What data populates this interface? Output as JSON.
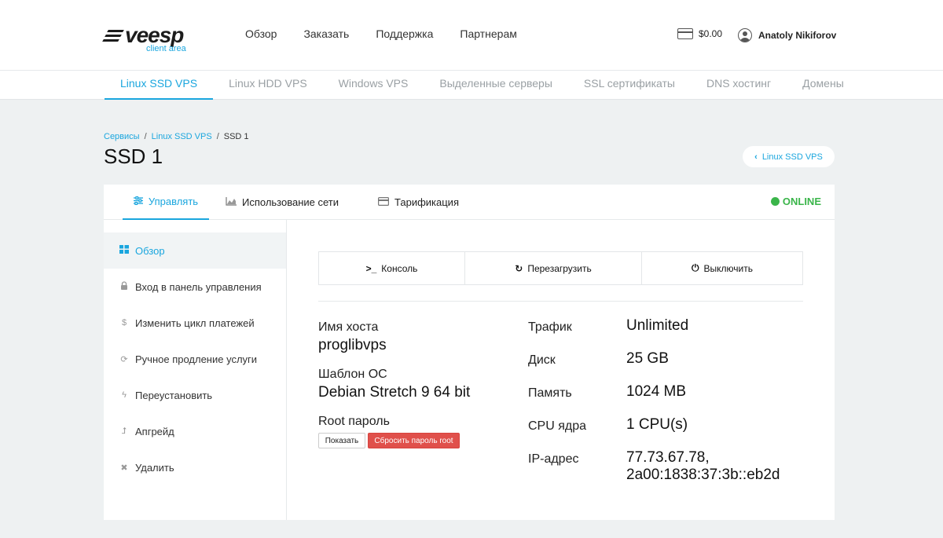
{
  "header": {
    "logo_text": "veesp",
    "logo_sub": "client area",
    "nav": [
      "Обзор",
      "Заказать",
      "Поддержка",
      "Партнерам"
    ],
    "balance": "$0.00",
    "user_name": "Anatoly Nikiforov"
  },
  "subnav": [
    "Linux SSD VPS",
    "Linux HDD VPS",
    "Windows VPS",
    "Выделенные серверы",
    "SSL сертификаты",
    "DNS хостинг",
    "Домены"
  ],
  "breadcrumb": {
    "root": "Сервисы",
    "section": "Linux SSD VPS",
    "current": "SSD 1"
  },
  "page_title": "SSD 1",
  "back_button": "Linux SSD VPS",
  "tabs": [
    "Управлять",
    "Использование сети",
    "Тарификация"
  ],
  "status": "ONLINE",
  "sidebar": [
    "Обзор",
    "Вход в панель управления",
    "Изменить цикл платежей",
    "Ручное продление услуги",
    "Переустановить",
    "Апгрейд",
    "Удалить"
  ],
  "actions": {
    "console": "Консоль",
    "reboot": "Перезагрузить",
    "shutdown": "Выключить"
  },
  "info_left": {
    "hostname_label": "Имя хоста",
    "hostname": "proglibvps",
    "os_label": "Шаблон ОС",
    "os": "Debian Stretch 9 64 bit",
    "root_label": "Root пароль",
    "show_btn": "Показать",
    "reset_btn": "Сбросить пароль root"
  },
  "info_right": {
    "traffic_label": "Трафик",
    "traffic": "Unlimited",
    "disk_label": "Диск",
    "disk": "25 GB",
    "memory_label": "Память",
    "memory": "1024 MB",
    "cpu_label": "CPU ядра",
    "cpu": "1 CPU(s)",
    "ip_label": "IP-адрес",
    "ip_v4": "77.73.67.78,",
    "ip_v6": "2a00:1838:37:3b::eb2d"
  },
  "colors": {
    "accent": "#1aa6de",
    "online": "#3ab54a",
    "danger": "#e0504b"
  }
}
